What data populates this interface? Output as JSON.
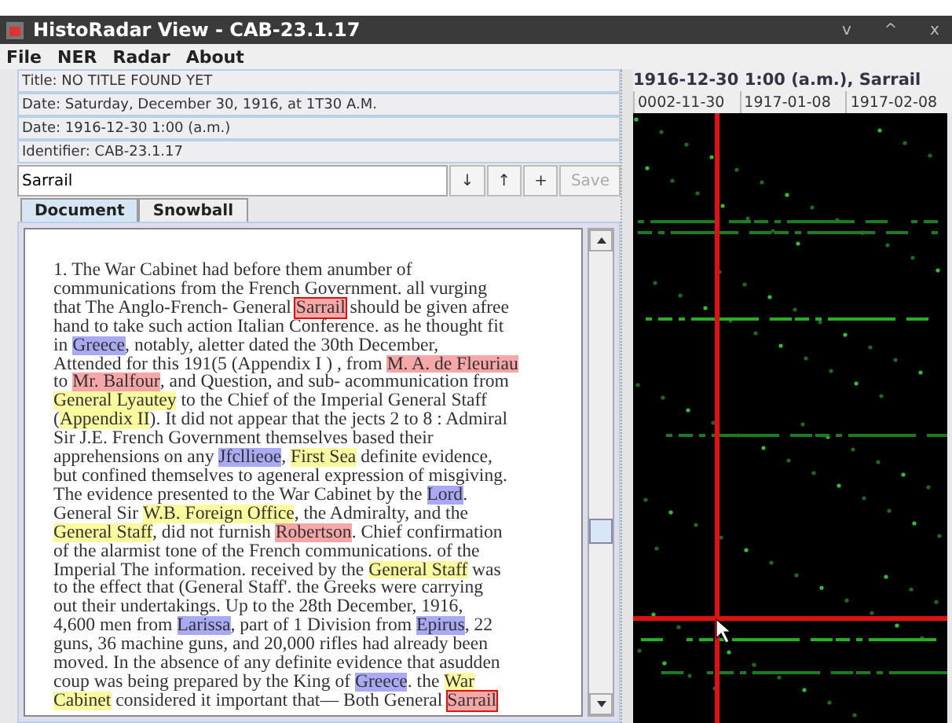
{
  "window": {
    "title": "HistoRadar View - CAB-23.1.17",
    "controls": [
      "v",
      "^",
      "x"
    ]
  },
  "menu": [
    "File",
    "NER",
    "Radar",
    "About"
  ],
  "fields": [
    "Title: NO TITLE FOUND YET",
    "Date: Saturday, December 30, 1916, at 1T30 A.M.",
    "Date: 1916-12-30 1:00 (a.m.)",
    "Identifier: CAB-23.1.17"
  ],
  "search": {
    "value": "Sarrail",
    "buttons": [
      {
        "label": "↓",
        "disabled": false
      },
      {
        "label": "↑",
        "disabled": false
      },
      {
        "label": "+",
        "disabled": false
      },
      {
        "label": "Save",
        "disabled": true
      }
    ]
  },
  "tabs": [
    {
      "label": "Document",
      "selected": true
    },
    {
      "label": "Snowball",
      "selected": false
    }
  ],
  "document": {
    "lines": [
      [
        {
          "text": "1. The War Cabinet had before them anumber of",
          "kind": "plain"
        }
      ],
      [
        {
          "text": "communications from the French Government. all vurging",
          "kind": "plain"
        }
      ],
      [
        {
          "text": "that The Anglo-French- General ",
          "kind": "plain"
        },
        {
          "text": "Sarrail",
          "kind": "person",
          "match": true
        },
        {
          "text": " should be given afree",
          "kind": "plain"
        }
      ],
      [
        {
          "text": "hand to take such action Italian Conference. as he thought fit",
          "kind": "plain"
        }
      ],
      [
        {
          "text": "in ",
          "kind": "plain"
        },
        {
          "text": "Greece",
          "kind": "place",
          "match": false
        },
        {
          "text": ", notably, aletter dated the 30th December,",
          "kind": "plain"
        }
      ],
      [
        {
          "text": "Attended for this 191(5 (Appendix I ) , from ",
          "kind": "plain"
        },
        {
          "text": "M. A. de Fleuriau",
          "kind": "person",
          "match": false
        }
      ],
      [
        {
          "text": "to ",
          "kind": "plain"
        },
        {
          "text": "Mr. Balfour",
          "kind": "person",
          "match": false
        },
        {
          "text": ", and Question, and sub- acommunication from",
          "kind": "plain"
        }
      ],
      [
        {
          "text": "General Lyautey",
          "kind": "org",
          "match": false
        },
        {
          "text": " to the Chief of the Imperial General Staff",
          "kind": "plain"
        }
      ],
      [
        {
          "text": "(",
          "kind": "plain"
        },
        {
          "text": "Appendix II",
          "kind": "org",
          "match": false
        },
        {
          "text": "). It did not appear that the jects 2 to 8 : Admiral",
          "kind": "plain"
        }
      ],
      [
        {
          "text": "Sir J.E. French Government themselves based their",
          "kind": "plain"
        }
      ],
      [
        {
          "text": "apprehensions on any ",
          "kind": "plain"
        },
        {
          "text": "Jfcllieoe",
          "kind": "place",
          "match": false
        },
        {
          "text": ", ",
          "kind": "plain"
        },
        {
          "text": "First Sea",
          "kind": "org",
          "match": false
        },
        {
          "text": " definite evidence,",
          "kind": "plain"
        }
      ],
      [
        {
          "text": "but confined themselves to ageneral expression of misgiving.",
          "kind": "plain"
        }
      ],
      [
        {
          "text": "The evidence presented to the War Cabinet by the ",
          "kind": "plain"
        },
        {
          "text": "Lord",
          "kind": "place",
          "match": false
        },
        {
          "text": ".",
          "kind": "plain"
        }
      ],
      [
        {
          "text": "General Sir ",
          "kind": "plain"
        },
        {
          "text": "W.B. Foreign Office",
          "kind": "org",
          "match": false
        },
        {
          "text": ", the Admiralty, and the",
          "kind": "plain"
        }
      ],
      [
        {
          "text": "General Staff",
          "kind": "org",
          "match": false
        },
        {
          "text": ", did not furnish ",
          "kind": "plain"
        },
        {
          "text": "Robertson",
          "kind": "person",
          "match": false
        },
        {
          "text": ". Chief confirmation",
          "kind": "plain"
        }
      ],
      [
        {
          "text": "of the alarmist tone of the French communications. of the",
          "kind": "plain"
        }
      ],
      [
        {
          "text": "Imperial The information. received by the ",
          "kind": "plain"
        },
        {
          "text": "General Staff",
          "kind": "org",
          "match": false
        },
        {
          "text": " was",
          "kind": "plain"
        }
      ],
      [
        {
          "text": "to the effect that (General Staff'. the Greeks were carrying",
          "kind": "plain"
        }
      ],
      [
        {
          "text": "out their undertakings. Up to the 28th December, 1916,",
          "kind": "plain"
        }
      ],
      [
        {
          "text": "4,600 men from ",
          "kind": "plain"
        },
        {
          "text": "Larissa",
          "kind": "place",
          "match": false
        },
        {
          "text": ", part of 1 Division from ",
          "kind": "plain"
        },
        {
          "text": "Epirus",
          "kind": "place",
          "match": false
        },
        {
          "text": ", 22",
          "kind": "plain"
        }
      ],
      [
        {
          "text": "guns, 36 machine guns, and 20,000 rifles had already been",
          "kind": "plain"
        }
      ],
      [
        {
          "text": "moved. In the absence of any definite evidence that asudden",
          "kind": "plain"
        }
      ],
      [
        {
          "text": "coup was being prepared by the King of ",
          "kind": "plain"
        },
        {
          "text": "Greece",
          "kind": "place",
          "match": false
        },
        {
          "text": ". the ",
          "kind": "plain"
        },
        {
          "text": "War",
          "kind": "org",
          "match": false
        }
      ],
      [
        {
          "text": "Cabinet",
          "kind": "org",
          "match": false
        },
        {
          "text": " considered it important that— Both General ",
          "kind": "plain"
        },
        {
          "text": "Sarrail",
          "kind": "person",
          "match": true
        }
      ]
    ]
  },
  "radar": {
    "title": "1916-12-30 1:00 (a.m.), Sarrail",
    "columns": [
      "0002-11-30",
      "1917-01-08",
      "1917-02-08"
    ]
  }
}
